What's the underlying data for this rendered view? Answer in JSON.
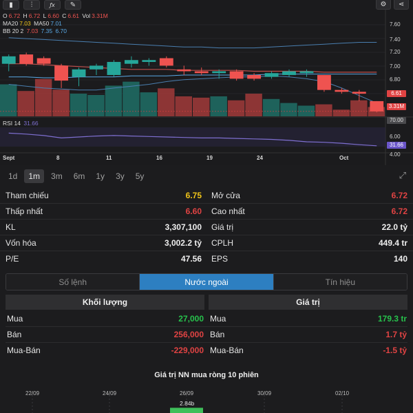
{
  "ohlc": {
    "o_label": "O",
    "o_value": "6.72",
    "h_label": "H",
    "h_value": "6.72",
    "l_label": "L",
    "l_value": "6.60",
    "c_label": "C",
    "c_value": "6.61",
    "vol_label": "Vol",
    "vol_value": "3.31M"
  },
  "ma": {
    "ma20_label": "MA20",
    "ma20_value": "7.03",
    "ma50_label": "MA50",
    "ma50_value": "7.01"
  },
  "bb": {
    "label": "BB 20 2",
    "v1": "7.03",
    "v2": "7.35",
    "v3": "6.70"
  },
  "rsi": {
    "label": "RSI 14",
    "value": "31.66"
  },
  "toolbar_icons": [
    "candlestick-icon",
    "indicator-icon",
    "fx-icon",
    "draw-icon"
  ],
  "toolbar_right_icons": [
    "gear-icon",
    "share-icon"
  ],
  "price_axis": [
    "7.60",
    "7.40",
    "7.20",
    "7.00",
    "6.80"
  ],
  "price_badges": {
    "last_price": "6.61",
    "volume": "3.31M"
  },
  "rsi_axis": {
    "top_badge": "70.00",
    "mid": "6.00",
    "low": "4.00",
    "current_badge": "31.66"
  },
  "date_axis": [
    "Sept",
    "8",
    "11",
    "16",
    "19",
    "24",
    "Oct"
  ],
  "colors": {
    "up": "#26a69a",
    "down": "#ef5350",
    "ma": "#5aa9e6",
    "bb": "#c0504d",
    "rsi": "#7e6fd0",
    "yellow": "#f0c419",
    "green": "#27c24c",
    "red": "#e04343",
    "accent": "#2d7fc1"
  },
  "chart_data": [
    {
      "type": "candlestick",
      "ohlc": [
        {
          "o": 7.12,
          "h": 7.22,
          "l": 7.04,
          "c": 7.2
        },
        {
          "o": 7.22,
          "h": 7.24,
          "l": 7.1,
          "c": 7.12
        },
        {
          "o": 7.18,
          "h": 7.2,
          "l": 7.1,
          "c": 7.12
        },
        {
          "o": 7.1,
          "h": 7.12,
          "l": 6.86,
          "c": 6.94
        },
        {
          "o": 6.98,
          "h": 7.08,
          "l": 6.88,
          "c": 7.06
        },
        {
          "o": 7.06,
          "h": 7.12,
          "l": 7.0,
          "c": 7.1
        },
        {
          "o": 7.0,
          "h": 7.16,
          "l": 6.98,
          "c": 7.14
        },
        {
          "o": 7.12,
          "h": 7.2,
          "l": 7.08,
          "c": 7.16
        },
        {
          "o": 7.14,
          "h": 7.18,
          "l": 7.1,
          "c": 7.16
        },
        {
          "o": 7.18,
          "h": 7.2,
          "l": 7.08,
          "c": 7.1
        },
        {
          "o": 7.06,
          "h": 7.1,
          "l": 7.0,
          "c": 7.04
        },
        {
          "o": 7.04,
          "h": 7.08,
          "l": 7.0,
          "c": 7.02
        },
        {
          "o": 7.02,
          "h": 7.06,
          "l": 6.96,
          "c": 7.04
        },
        {
          "o": 7.04,
          "h": 7.06,
          "l": 6.94,
          "c": 6.96
        },
        {
          "o": 7.0,
          "h": 7.02,
          "l": 6.94,
          "c": 6.96
        },
        {
          "o": 6.98,
          "h": 7.04,
          "l": 6.96,
          "c": 7.02
        },
        {
          "o": 7.0,
          "h": 7.06,
          "l": 6.98,
          "c": 7.04
        },
        {
          "o": 7.02,
          "h": 7.06,
          "l": 6.98,
          "c": 7.04
        },
        {
          "o": 7.0,
          "h": 7.0,
          "l": 6.82,
          "c": 6.84
        },
        {
          "o": 6.84,
          "h": 6.86,
          "l": 6.8,
          "c": 6.82
        },
        {
          "o": 6.82,
          "h": 6.84,
          "l": 6.72,
          "c": 6.8
        },
        {
          "o": 6.72,
          "h": 6.72,
          "l": 6.6,
          "c": 6.61
        }
      ],
      "volume": [
        2.4,
        1.9,
        2.8,
        2.0,
        1.7,
        1.6,
        2.3,
        2.6,
        1.8,
        2.1,
        1.5,
        1.4,
        1.5,
        1.2,
        1.7,
        1.3,
        1.0,
        0.8,
        0.9,
        0.5,
        1.2,
        0.7
      ],
      "ma20": [
        7.12,
        7.12,
        7.11,
        7.1,
        7.09,
        7.08,
        7.07,
        7.06,
        7.06,
        7.06,
        7.05,
        7.05,
        7.05,
        7.05,
        7.04,
        7.04,
        7.04,
        7.04,
        7.03,
        7.03,
        7.03,
        7.03
      ],
      "ma50": [
        6.98,
        6.98,
        6.97,
        6.97,
        6.98,
        6.98,
        6.98,
        6.99,
        6.99,
        6.99,
        7.0,
        7.0,
        7.0,
        7.0,
        7.0,
        7.01,
        7.01,
        7.01,
        7.01,
        7.01,
        7.01,
        7.01
      ],
      "bb_upper": [
        7.4,
        7.39,
        7.38,
        7.37,
        7.36,
        7.35,
        7.34,
        7.33,
        7.32,
        7.31,
        7.3,
        7.3,
        7.29,
        7.29,
        7.29,
        7.3,
        7.31,
        7.32,
        7.33,
        7.34,
        7.35,
        7.35
      ],
      "bb_lower": [
        6.9,
        6.88,
        6.86,
        6.85,
        6.84,
        6.84,
        6.86,
        6.88,
        6.9,
        6.93,
        6.95,
        6.96,
        6.97,
        6.98,
        6.98,
        6.99,
        6.98,
        6.96,
        6.93,
        6.86,
        6.78,
        6.7
      ],
      "ylim": [
        6.55,
        7.7
      ]
    },
    {
      "type": "line",
      "title": "RSI 14",
      "values": [
        58,
        56,
        53,
        48,
        50,
        52,
        53,
        52,
        51,
        50,
        49,
        48,
        48,
        47,
        46,
        45,
        43,
        40,
        39,
        37,
        34,
        31.66
      ],
      "ylim": [
        20,
        80
      ]
    },
    {
      "type": "bar",
      "title": "Giá trị NN mua ròng 10 phiên",
      "categories": [
        "22/09",
        "24/09",
        "26/09",
        "30/09",
        "02/10"
      ],
      "values": [
        null,
        null,
        2.84,
        null,
        null
      ],
      "value_labels": [
        "",
        "",
        "2.84b",
        "",
        ""
      ]
    }
  ],
  "periods": [
    "1d",
    "1m",
    "3m",
    "6m",
    "1y",
    "3y",
    "5y"
  ],
  "period_active": "1m",
  "stats": {
    "ref_label": "Tham chiếu",
    "ref_value": "6.75",
    "open_label": "Mở cửa",
    "open_value": "6.72",
    "low_label": "Thấp nhất",
    "low_value": "6.60",
    "high_label": "Cao nhất",
    "high_value": "6.72",
    "kl_label": "KL",
    "kl_value": "3,307,100",
    "gt_label": "Giá trị",
    "gt_value": "22.0 tỷ",
    "cap_label": "Vốn hóa",
    "cap_value": "3,002.2 tỷ",
    "cplh_label": "CPLH",
    "cplh_value": "449.4 tr",
    "pe_label": "P/E",
    "pe_value": "47.56",
    "eps_label": "EPS",
    "eps_value": "140"
  },
  "tabs": [
    "Số lệnh",
    "Nước ngoài",
    "Tín hiệu"
  ],
  "tab_active": "Nước ngoài",
  "foreign": {
    "vol_header": "Khối lượng",
    "val_header": "Giá trị",
    "buy_label": "Mua",
    "buy_vol": "27,000",
    "buy_val": "179.3 tr",
    "sell_label": "Bán",
    "sell_vol": "256,000",
    "sell_val": "1.7 tỷ",
    "net_label": "Mua-Bán",
    "net_vol": "-229,000",
    "net_val": "-1.5 tỷ"
  },
  "net_chart": {
    "title": "Giá trị NN mua ròng 10 phiên"
  }
}
